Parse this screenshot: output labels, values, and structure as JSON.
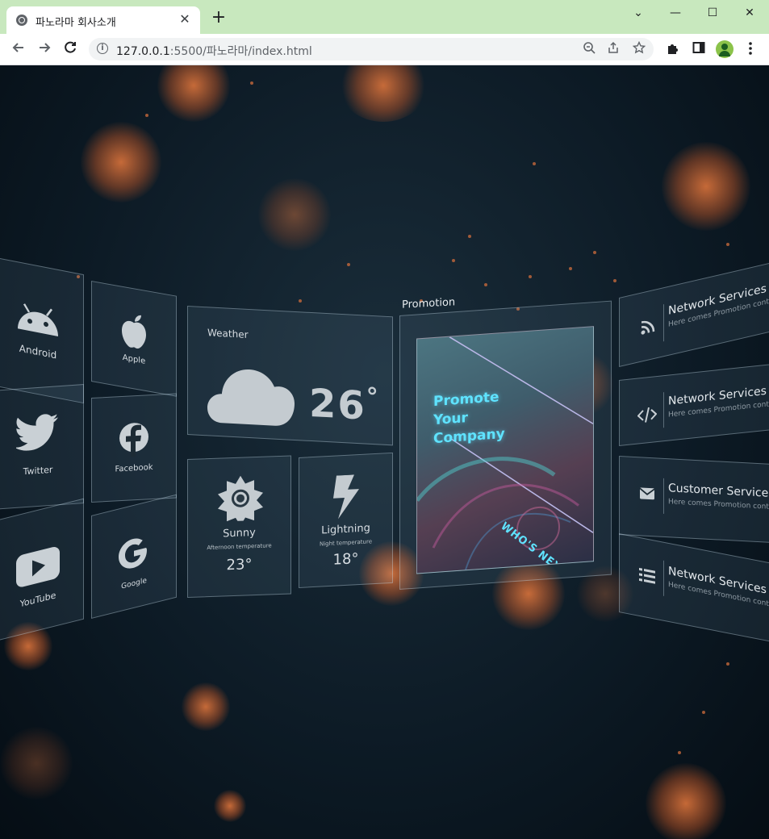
{
  "browser": {
    "tab_title": "파노라마 회사소개",
    "tab_close": "✕",
    "new_tab": "+",
    "url_host": "127.0.0.1",
    "url_rest": ":5500/파노라마/index.html",
    "window": {
      "minimize": "—",
      "maximize": "☐",
      "close": "✕",
      "menu": "⌄"
    }
  },
  "social": [
    {
      "label": "Android",
      "icon": "android-icon"
    },
    {
      "label": "Apple",
      "icon": "apple-icon"
    },
    {
      "label": "Twitter",
      "icon": "twitter-icon"
    },
    {
      "label": "Facebook",
      "icon": "facebook-icon"
    },
    {
      "label": "YouTube",
      "icon": "youtube-icon"
    },
    {
      "label": "Google",
      "icon": "google-icon"
    }
  ],
  "weather": {
    "title": "Weather",
    "temp": "26",
    "degree": "°",
    "sunny": {
      "label": "Sunny",
      "sub": "Afternoon temperature",
      "temp": "23°"
    },
    "lightning": {
      "label": "Lightning",
      "sub": "Night temperature",
      "temp": "18°"
    }
  },
  "promotion": {
    "title": "Promotion",
    "line1": "Promote",
    "line2": "Your",
    "line3": "Company",
    "tag": "WHO'S NEXT?"
  },
  "services": [
    {
      "title": "Network Services",
      "sub": "Here comes Promotion contents",
      "icon": "rss-icon"
    },
    {
      "title": "Network Services",
      "sub": "Here comes Promotion contents",
      "icon": "code-icon"
    },
    {
      "title": "Customer Services",
      "sub": "Here comes Promotion contents",
      "icon": "mail-icon"
    },
    {
      "title": "Network Services",
      "sub": "Here comes Promotion contents",
      "icon": "list-icon"
    }
  ],
  "colors": {
    "accent": "#5fe3ff",
    "panel_text": "#d7dde2",
    "bokeh": "#e0783c",
    "tabbar": "#c8e8be"
  }
}
